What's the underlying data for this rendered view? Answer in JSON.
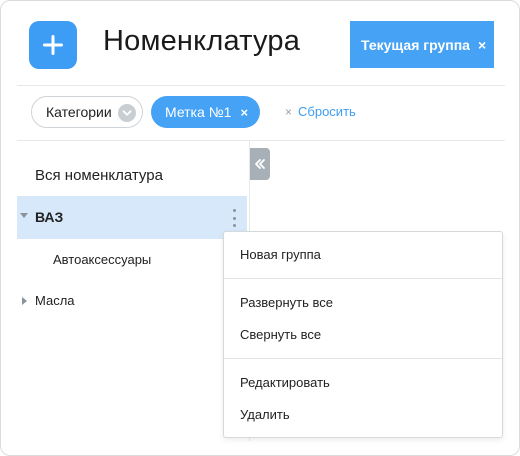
{
  "header": {
    "title": "Номенклатура",
    "add_icon": "plus-icon",
    "current_group_label": "Текущая группа",
    "current_group_close": "×"
  },
  "filters": {
    "categories_label": "Категории",
    "categories_icon": "chevron-down-icon",
    "tag_label": "Метка №1",
    "tag_close": "×",
    "reset_prefix": "×",
    "reset_label": "Сбросить"
  },
  "tree": {
    "all_label": "Вся номенклатура",
    "items": [
      {
        "label": "ВАЗ",
        "expanded": true,
        "selected": true
      },
      {
        "label": "Автоаксессуары",
        "child": true
      },
      {
        "label": "Масла",
        "expanded": false
      }
    ],
    "collapse_icon": "double-chevron-left-icon"
  },
  "context_menu": {
    "new_group": "Новая группа",
    "expand_all": "Развернуть все",
    "collapse_all": "Свернуть все",
    "edit": "Редактировать",
    "delete": "Удалить"
  },
  "colors": {
    "accent": "#3d9cf3",
    "selected_row": "#d6e8f9",
    "muted_icon": "#8a9399"
  }
}
